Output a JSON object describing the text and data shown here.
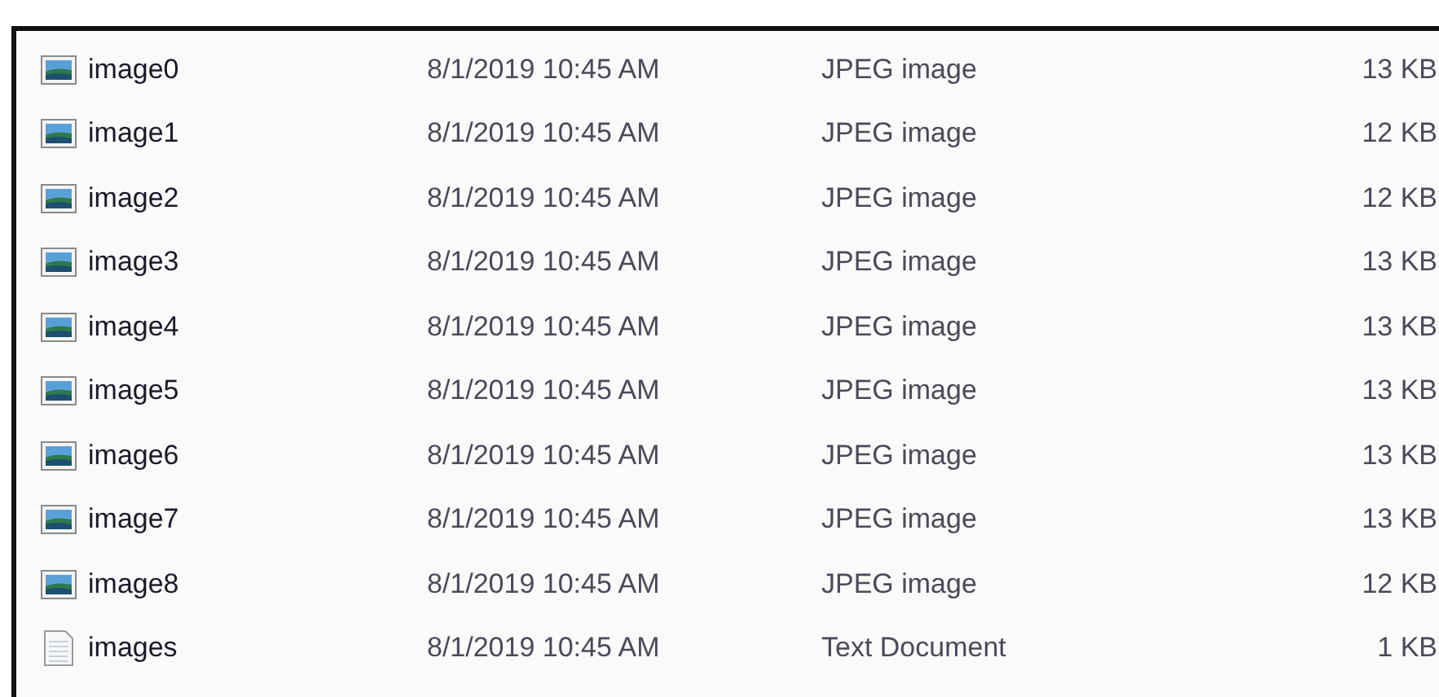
{
  "files": [
    {
      "kind": "image",
      "name": "image0",
      "modified": "8/1/2019 10:45 AM",
      "type": "JPEG image",
      "size": "13 KB"
    },
    {
      "kind": "image",
      "name": "image1",
      "modified": "8/1/2019 10:45 AM",
      "type": "JPEG image",
      "size": "12 KB"
    },
    {
      "kind": "image",
      "name": "image2",
      "modified": "8/1/2019 10:45 AM",
      "type": "JPEG image",
      "size": "12 KB"
    },
    {
      "kind": "image",
      "name": "image3",
      "modified": "8/1/2019 10:45 AM",
      "type": "JPEG image",
      "size": "13 KB"
    },
    {
      "kind": "image",
      "name": "image4",
      "modified": "8/1/2019 10:45 AM",
      "type": "JPEG image",
      "size": "13 KB"
    },
    {
      "kind": "image",
      "name": "image5",
      "modified": "8/1/2019 10:45 AM",
      "type": "JPEG image",
      "size": "13 KB"
    },
    {
      "kind": "image",
      "name": "image6",
      "modified": "8/1/2019 10:45 AM",
      "type": "JPEG image",
      "size": "13 KB"
    },
    {
      "kind": "image",
      "name": "image7",
      "modified": "8/1/2019 10:45 AM",
      "type": "JPEG image",
      "size": "13 KB"
    },
    {
      "kind": "image",
      "name": "image8",
      "modified": "8/1/2019 10:45 AM",
      "type": "JPEG image",
      "size": "12 KB"
    },
    {
      "kind": "text",
      "name": "images",
      "modified": "8/1/2019 10:45 AM",
      "type": "Text Document",
      "size": "1 KB"
    }
  ]
}
